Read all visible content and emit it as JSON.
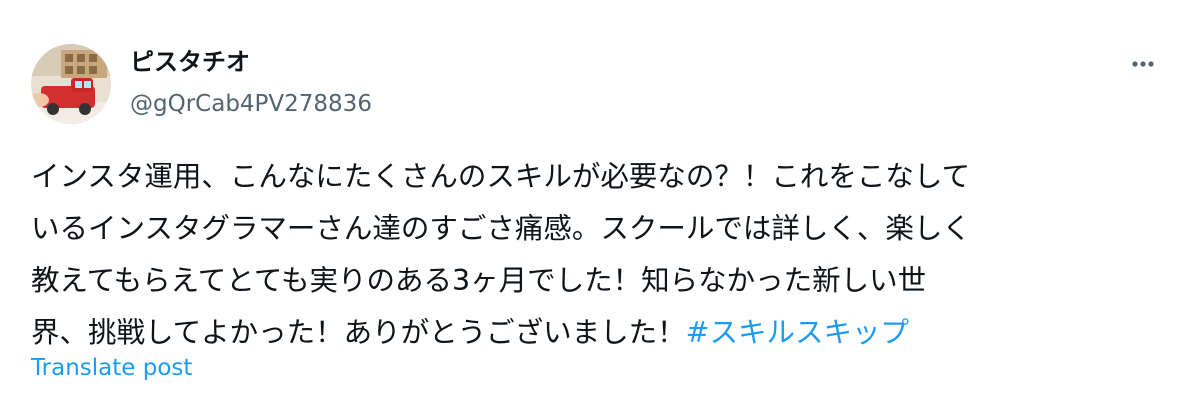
{
  "author": {
    "display_name": "ピスタチオ",
    "handle": "@gQrCab4PV278836"
  },
  "menu": {
    "icon": "more-horizontal-icon"
  },
  "post": {
    "lines": [
      "インスタ運用、こんなにたくさんのスキルが必要なの？！これをこなして",
      "いるインスタグラマーさん達のすごさ痛感。スクールでは詳しく、楽しく",
      "教えてもらえてとても実りのある3ヶ月でした！知らなかった新しい世",
      "界、挑戦してよかった！ありがとうございました！"
    ],
    "hashtag": "#スキルスキップ"
  },
  "translate": {
    "label": "Translate post"
  },
  "colors": {
    "text": "#0f1419",
    "secondary": "#536471",
    "link": "#1d9bf0"
  }
}
